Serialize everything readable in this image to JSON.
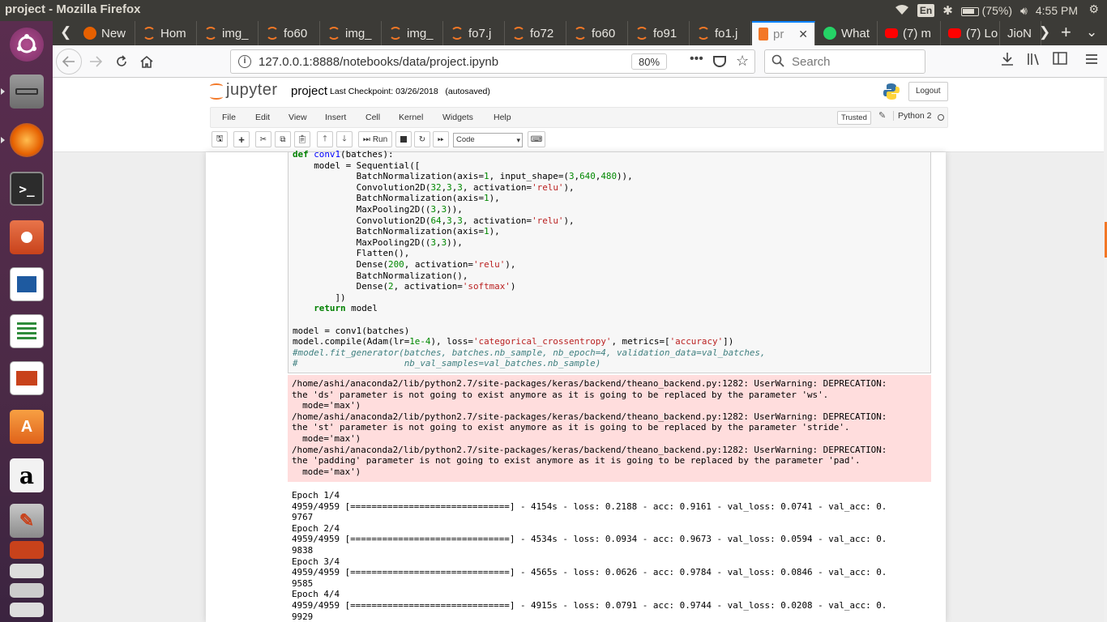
{
  "system": {
    "window_title": "project - Mozilla Firefox",
    "lang": "En",
    "battery": "(75%)",
    "clock": "4:55 PM"
  },
  "launcher": {
    "items": [
      "ubuntu-dash",
      "files",
      "firefox",
      "terminal",
      "file-manager",
      "libreoffice-impress",
      "libreoffice-calc",
      "libreoffice-writer",
      "software-center",
      "amazon",
      "settings",
      "launcher-item",
      "launcher-item",
      "launcher-item",
      "launcher-item"
    ]
  },
  "tabs": [
    {
      "label": "New",
      "icon": "firefox-icon",
      "color": "#e66000"
    },
    {
      "label": "Hom",
      "icon": "jupyter-icon",
      "color": "#f37726"
    },
    {
      "label": "img_",
      "icon": "jupyter-icon",
      "color": "#f37726"
    },
    {
      "label": "fo60",
      "icon": "jupyter-icon",
      "color": "#f37726"
    },
    {
      "label": "img_",
      "icon": "jupyter-icon",
      "color": "#f37726"
    },
    {
      "label": "img_",
      "icon": "jupyter-icon",
      "color": "#f37726"
    },
    {
      "label": "fo7.j",
      "icon": "jupyter-icon",
      "color": "#f37726"
    },
    {
      "label": "fo72",
      "icon": "jupyter-icon",
      "color": "#f37726"
    },
    {
      "label": "fo60",
      "icon": "jupyter-icon",
      "color": "#f37726"
    },
    {
      "label": "fo91",
      "icon": "jupyter-icon",
      "color": "#f37726"
    },
    {
      "label": "fo1.j",
      "icon": "jupyter-icon",
      "color": "#f37726"
    },
    {
      "label": "pr",
      "icon": "notebook-icon",
      "color": "#f37726"
    },
    {
      "label": "What",
      "icon": "whatsapp-icon",
      "color": "#25d366"
    },
    {
      "label": "(7) m",
      "icon": "youtube-icon",
      "color": "#ff0000"
    },
    {
      "label": "(7) Lo",
      "icon": "youtube-icon",
      "color": "#ff0000"
    },
    {
      "label": "JioN",
      "icon": "none",
      "color": "#3c3b37"
    }
  ],
  "navbar": {
    "url": "127.0.0.1:8888/notebooks/data/project.ipynb",
    "zoom": "80%",
    "search_placeholder": "Search"
  },
  "jupyter": {
    "logo_text": "jupyter",
    "notebook_name": "project",
    "checkpoint": "Last Checkpoint: 03/26/2018   (autosaved)",
    "logout": "Logout",
    "menu": [
      "File",
      "Edit",
      "View",
      "Insert",
      "Cell",
      "Kernel",
      "Widgets",
      "Help"
    ],
    "trusted": "Trusted",
    "kernel": "Python 2",
    "run_label": "Run",
    "cell_type": "Code"
  },
  "colors": {
    "accent": "#f37726",
    "stderr_bg": "#ffdddd",
    "tab_highlight": "#0a84ff"
  }
}
